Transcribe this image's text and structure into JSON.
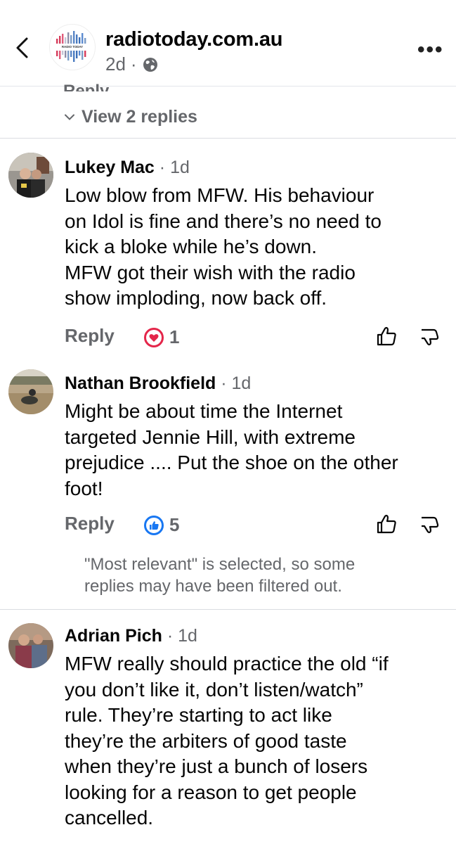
{
  "header": {
    "page_name": "radiotoday.com.au",
    "timestamp": "2d",
    "separator_dot": "·",
    "privacy_icon": "globe-icon",
    "back_icon": "chevron-left-icon",
    "more_label": "•••",
    "logo_text": "RADIO TODAY"
  },
  "thread": {
    "partial_reply_label": "Reply",
    "view_replies_label": "View 2 replies"
  },
  "comments": [
    {
      "author": "Lukey Mac",
      "time": "1d",
      "lines": [
        "Low blow from MFW. His behaviour",
        "on Idol is fine and there’s no need to",
        "kick a bloke while he’s down.",
        "MFW got their wish with the radio",
        "show imploding, now back off."
      ],
      "reply_label": "Reply",
      "reaction_type": "love",
      "reaction_count": "1"
    },
    {
      "author": "Nathan Brookfield",
      "time": "1d",
      "lines": [
        "Might be about time the Internet",
        "targeted Jennie Hill, with extreme",
        "prejudice .... Put the shoe on the other",
        "foot!"
      ],
      "reply_label": "Reply",
      "reaction_type": "like",
      "reaction_count": "5"
    },
    {
      "author": "Adrian Pich",
      "time": "1d",
      "lines": [
        "MFW really should practice the old “if",
        "you don’t like it, don’t listen/watch”",
        "rule. They’re starting to act like",
        "they’re the arbiters of good taste",
        "when they’re just a bunch of losers",
        "looking for a reason to get people",
        "cancelled."
      ]
    }
  ],
  "notice": {
    "line1": "\"Most relevant\" is selected, so some",
    "line2": "replies may have been filtered out."
  },
  "colors": {
    "secondary_text": "#65676b",
    "love_red": "#e4264a",
    "like_blue": "#1877f2",
    "primary_text": "#050505"
  }
}
